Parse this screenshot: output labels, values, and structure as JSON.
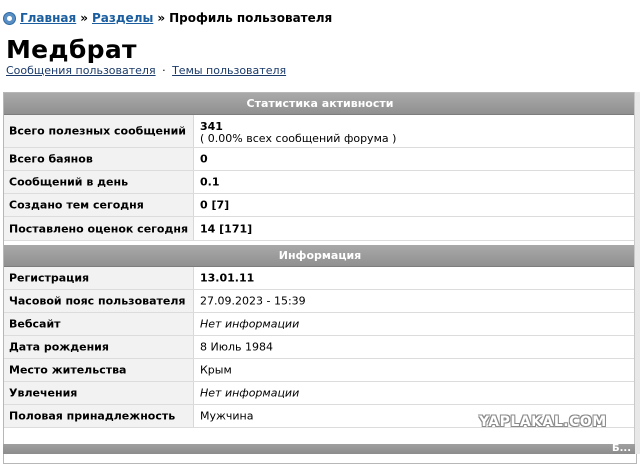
{
  "breadcrumb": {
    "home": "Главная",
    "sep": "»",
    "sections": "Разделы",
    "current": "Профиль пользователя"
  },
  "profile": {
    "username": "Медбрат",
    "links": {
      "posts": "Сообщения пользователя",
      "dot": "·",
      "topics": "Темы пользователя"
    }
  },
  "activity": {
    "header": "Статистика активности",
    "rows": [
      {
        "label": "Всего полезных сообщений",
        "value": "341",
        "note": "( 0.00% всех сообщений форума )"
      },
      {
        "label": "Всего баянов",
        "value": "0"
      },
      {
        "label": "Сообщений в день",
        "value": "0.1"
      },
      {
        "label": "Создано тем сегодня",
        "value": "0 [7]"
      },
      {
        "label": "Поставлено оценок сегодня",
        "value": "14 [171]"
      }
    ]
  },
  "info": {
    "header": "Информация",
    "rows": [
      {
        "label": "Регистрация",
        "value": "13.01.11"
      },
      {
        "label": "Часовой пояс пользователя",
        "value": "27.09.2023 - 15:39"
      },
      {
        "label": "Вебсайт",
        "value": "Нет информации"
      },
      {
        "label": "Дата рождения",
        "value": "8 Июль 1984"
      },
      {
        "label": "Место жительства",
        "value": "Крым"
      },
      {
        "label": "Увлечения",
        "value": "Нет информации"
      },
      {
        "label": "Половая принадлежность",
        "value": "Мужчина"
      }
    ]
  },
  "watermark": "YAPLAKAL.COM",
  "footer_text": "Б..."
}
